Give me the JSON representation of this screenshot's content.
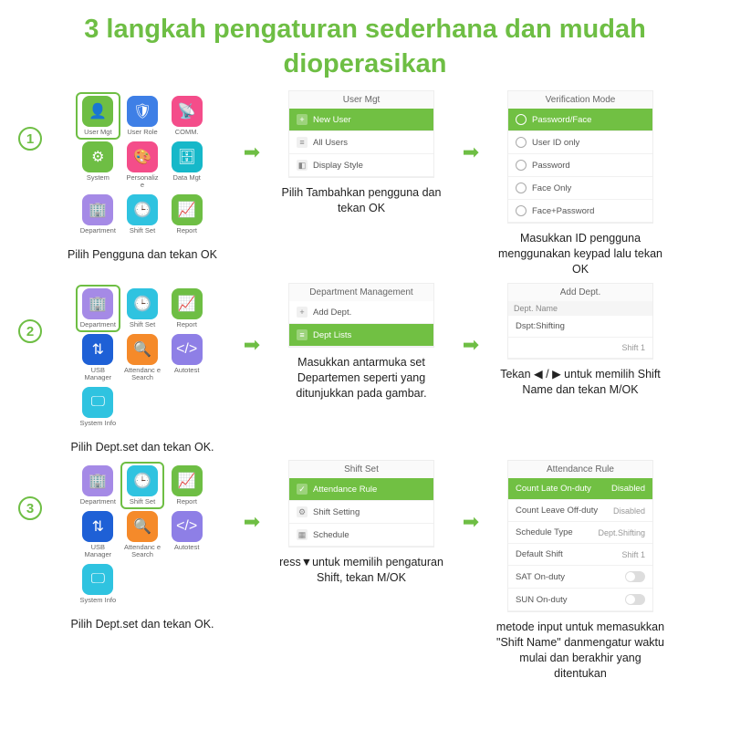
{
  "title": "3 langkah pengaturan sederhana dan mudah dioperasikan",
  "arrow": "➡",
  "steps": [
    {
      "caption_a": "Pilih Pengguna dan tekan OK",
      "caption_b": "Pilih Tambahkan pengguna dan tekan OK",
      "caption_c": "Masukkan ID pengguna menggunakan keypad lalu tekan OK",
      "grid": [
        {
          "label": "User Mgt",
          "color": "c-green",
          "icon": "👤",
          "sel": true
        },
        {
          "label": "User Role",
          "color": "c-blue",
          "icon": "🛡"
        },
        {
          "label": "COMM.",
          "color": "c-pink",
          "icon": "📡"
        },
        {
          "label": "System",
          "color": "c-green",
          "icon": "⚙"
        },
        {
          "label": "Personaliz e",
          "color": "c-pink",
          "icon": "🎨"
        },
        {
          "label": "Data Mgt",
          "color": "c-teal",
          "icon": "🗄"
        },
        {
          "label": "Department",
          "color": "c-lav",
          "icon": "🏢"
        },
        {
          "label": "Shift Set",
          "color": "c-cyan",
          "icon": "🕒"
        },
        {
          "label": "Report",
          "color": "c-green",
          "icon": "📈"
        }
      ],
      "panel_b": {
        "title": "User Mgt",
        "items": [
          {
            "label": "New User",
            "sel": true,
            "icon": "+"
          },
          {
            "label": "All Users",
            "icon": "≡"
          },
          {
            "label": "Display Style",
            "icon": "◧"
          }
        ]
      },
      "panel_c": {
        "title": "Verification Mode",
        "radios": [
          {
            "label": "Password/Face",
            "sel": true
          },
          {
            "label": "User ID only"
          },
          {
            "label": "Password"
          },
          {
            "label": "Face Only"
          },
          {
            "label": "Face+Password"
          }
        ]
      }
    },
    {
      "caption_a": "Pilih Dept.set dan tekan OK.",
      "caption_b": "Masukkan antarmuka set Departemen seperti yang ditunjukkan pada gambar.",
      "caption_c": "Tekan ◀ / ▶ untuk memilih Shift Name dan tekan M/OK",
      "grid": [
        {
          "label": "Department",
          "color": "c-lav",
          "icon": "🏢",
          "sel": true
        },
        {
          "label": "Shift Set",
          "color": "c-cyan",
          "icon": "🕒"
        },
        {
          "label": "Report",
          "color": "c-green",
          "icon": "📈"
        },
        {
          "label": "USB Manager",
          "color": "c-drkbl",
          "icon": "⇅"
        },
        {
          "label": "Attendanc e Search",
          "color": "c-orange",
          "icon": "🔍"
        },
        {
          "label": "Autotest",
          "color": "c-purple",
          "icon": "</>"
        },
        {
          "label": "System Info",
          "color": "c-cyan",
          "icon": "🖵"
        }
      ],
      "panel_b": {
        "title": "Department Management",
        "items": [
          {
            "label": "Add Dept.",
            "icon": "+"
          },
          {
            "label": "Dept Lists",
            "sel": true,
            "icon": "≡"
          }
        ]
      },
      "panel_c": {
        "title": "Add Dept.",
        "sub": "Dept. Name",
        "kv": [
          {
            "k": "Dspt:Shifting",
            "v": ""
          },
          {
            "k": "",
            "v": "Shift 1"
          }
        ]
      }
    },
    {
      "caption_a": "Pilih Dept.set dan tekan OK.",
      "caption_b": "ress▼untuk memilih pengaturan Shift, tekan M/OK",
      "caption_c": "metode input untuk memasukkan \"Shift Name\" danmengatur waktu mulai dan berakhir yang ditentukan",
      "grid": [
        {
          "label": "Department",
          "color": "c-lav",
          "icon": "🏢"
        },
        {
          "label": "Shift Set",
          "color": "c-cyan",
          "icon": "🕒",
          "sel": true
        },
        {
          "label": "Report",
          "color": "c-green",
          "icon": "📈"
        },
        {
          "label": "USB Manager",
          "color": "c-drkbl",
          "icon": "⇅"
        },
        {
          "label": "Attendanc e Search",
          "color": "c-orange",
          "icon": "🔍"
        },
        {
          "label": "Autotest",
          "color": "c-purple",
          "icon": "</>"
        },
        {
          "label": "System Info",
          "color": "c-cyan",
          "icon": "🖵"
        }
      ],
      "panel_b": {
        "title": "Shift Set",
        "items": [
          {
            "label": "Attendance Rule",
            "sel": true,
            "icon": "✓"
          },
          {
            "label": "Shift Setting",
            "icon": "⚙"
          },
          {
            "label": "Schedule",
            "icon": "▦"
          }
        ]
      },
      "panel_c": {
        "title": "Attendance Rule",
        "kv": [
          {
            "k": "Count Late On-duty",
            "v": "Disabled",
            "sel": true
          },
          {
            "k": "Count Leave Off-duty",
            "v": "Disabled"
          },
          {
            "k": "Schedule Type",
            "v": "Dept.Shifting"
          },
          {
            "k": "Default Shift",
            "v": "Shift 1"
          },
          {
            "k": "SAT On-duty",
            "toggle": true
          },
          {
            "k": "SUN On-duty",
            "toggle": true
          }
        ]
      }
    }
  ]
}
